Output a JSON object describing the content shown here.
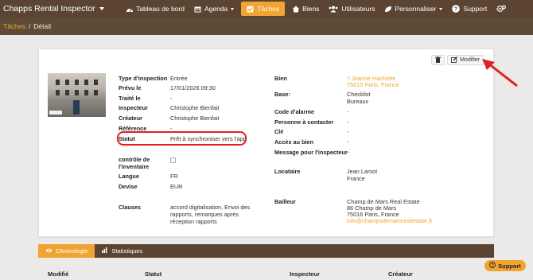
{
  "navbar": {
    "brand": "Chapps Rental Inspector",
    "items": [
      {
        "label": "Tableau de bord",
        "icon": "dashboard-icon"
      },
      {
        "label": "Agenda",
        "icon": "calendar-icon",
        "dropdown": true
      },
      {
        "label": "Tâches",
        "icon": "tasks-icon",
        "active": true
      },
      {
        "label": "Biens",
        "icon": "home-icon"
      },
      {
        "label": "Utilisateurs",
        "icon": "users-icon"
      },
      {
        "label": "Personnaliser",
        "icon": "leaf-icon",
        "dropdown": true
      },
      {
        "label": "Support",
        "icon": "question-icon"
      }
    ],
    "settings_icon": "gears-icon"
  },
  "breadcrumb": {
    "parent": "Tâches",
    "separator": "/",
    "current": "Détail"
  },
  "actions": {
    "delete_icon": "trash-icon",
    "edit_label": "Modifier"
  },
  "inspection": {
    "type_label": "Type d'inspection",
    "type_value": "Entrée",
    "planned_label": "Prévu le",
    "planned_value": "17/01/2026 09:30",
    "processed_label": "Traité le",
    "processed_value": "-",
    "inspector_label": "Inspecteur",
    "inspector_value": "Christophe Bienfait",
    "creator_label": "Créateur",
    "creator_value": "Christophe Bienfait",
    "reference_label": "Référence",
    "reference_value": "-",
    "status_label": "Statut",
    "status_value": "Prêt à synchroniser vers l'app",
    "inventory_label_1": "contrôle de",
    "inventory_label_2": "l'inventaire",
    "language_label": "Langue",
    "language_value": "FR",
    "currency_label": "Devise",
    "currency_value": "EUR",
    "clauses_label": "Clauses",
    "clauses_line1": "accord digitalisation, Envoi des",
    "clauses_line2": "rapports, remarques après",
    "clauses_line3": "réception rapports"
  },
  "property": {
    "bien_label": "Bien",
    "bien_line1": "7 Jeanne Hachette",
    "bien_line2": "75015 Paris, France",
    "base_label": "Base:",
    "base_line1": "Checklist",
    "base_line2": "Bureaux",
    "alarm_label": "Code d'alarme",
    "alarm_value": "-",
    "contact_label": "Personne à contacter",
    "contact_value": "-",
    "key_label": "Clé",
    "key_value": "-",
    "access_label": "Accès au bien",
    "access_value": "-",
    "message_label": "Message pour l'inspecteur",
    "message_value": "-",
    "tenant_label": "Locataire",
    "tenant_line1": "Jean Lamot",
    "tenant_line2": "France",
    "landlord_label": "Bailleur",
    "landlord_line1": "Champ de Mars Real Estate",
    "landlord_line2": "86 Champ de Mars",
    "landlord_line3": "75016 Paris, France",
    "landlord_email": "info@champsdemarsrealestate.fr"
  },
  "tabs": [
    {
      "label": "Chronologie",
      "icon": "eye-icon",
      "active": true
    },
    {
      "label": "Statistiques",
      "icon": "bar-chart-icon"
    }
  ],
  "table_headers": [
    "Modifié",
    "Statut",
    "Inspecteur",
    "Créateur"
  ],
  "support_button": "Support",
  "colors": {
    "nav": "#5b4532",
    "accent": "#f0a431",
    "highlight": "#e02020"
  }
}
